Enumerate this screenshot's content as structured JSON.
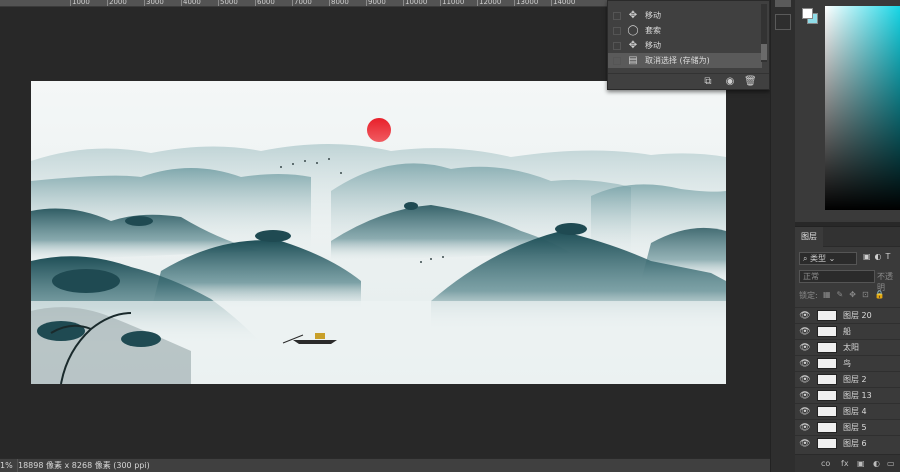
{
  "ruler": {
    "ticks": [
      "1000",
      "2000",
      "3000",
      "4000",
      "5000",
      "6000",
      "7000",
      "8000",
      "9000",
      "10000",
      "11000",
      "12000",
      "13000",
      "14000"
    ]
  },
  "history": {
    "items": [
      {
        "label": "移动",
        "icon": "move-icon"
      },
      {
        "label": "套索",
        "icon": "lasso-icon"
      },
      {
        "label": "移动",
        "icon": "move-icon"
      },
      {
        "label": "取消选择 (存储为)",
        "icon": "document-icon"
      }
    ]
  },
  "colors": {
    "foreground": "#ffffff",
    "background": "#8fdce8",
    "accent": "#18d6e6",
    "sun": "#e8202a"
  },
  "layers_panel": {
    "tab": "图层",
    "filter_label": "类型",
    "blend_mode": "正常",
    "opacity_label": "不透明",
    "lock_label": "锁定:",
    "layers": [
      {
        "name": "图层 20"
      },
      {
        "name": "船"
      },
      {
        "name": "太阳"
      },
      {
        "name": "鸟"
      },
      {
        "name": "图层 2"
      },
      {
        "name": "图层 13"
      },
      {
        "name": "图层 4"
      },
      {
        "name": "图层 5"
      },
      {
        "name": "图层 6"
      }
    ],
    "bottom_icons": [
      "co",
      "fx"
    ]
  },
  "status": {
    "zoom": "1%",
    "info": "18898 像素 x 8268 像素 (300 ppi)"
  }
}
